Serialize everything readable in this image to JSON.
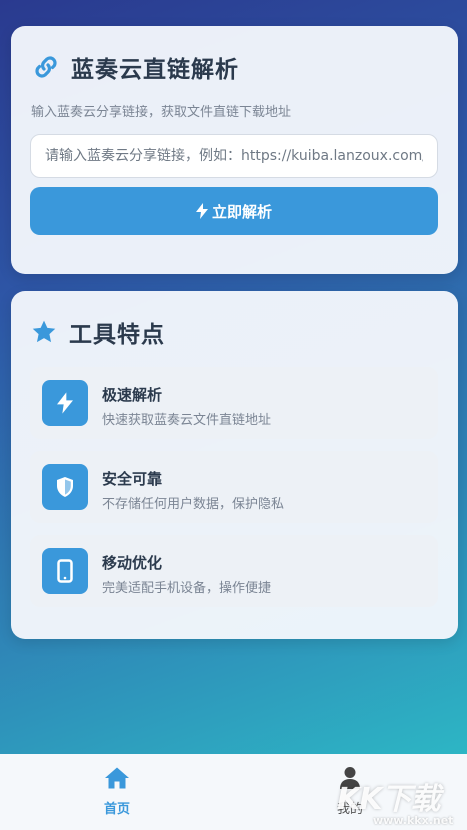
{
  "parse_card": {
    "title": "蓝奏云直链解析",
    "subtitle": "输入蓝奏云分享链接，获取文件直链下载地址",
    "input_placeholder": "请输入蓝奏云分享链接，例如：https://kuiba.lanzoux.com/xxx",
    "input_value": "",
    "button_label": "立即解析"
  },
  "features_card": {
    "title": "工具特点",
    "items": [
      {
        "icon": "bolt-icon",
        "name": "极速解析",
        "desc": "快速获取蓝奏云文件直链地址"
      },
      {
        "icon": "shield-icon",
        "name": "安全可靠",
        "desc": "不存储任何用户数据，保护隐私"
      },
      {
        "icon": "mobile-icon",
        "name": "移动优化",
        "desc": "完美适配手机设备，操作便捷"
      }
    ]
  },
  "bottom_nav": {
    "items": [
      {
        "label": "首页",
        "icon": "home-icon",
        "active": true
      },
      {
        "label": "我的",
        "icon": "user-icon",
        "active": false
      }
    ]
  },
  "watermark": {
    "text": "KK下载",
    "url": "www.kkx.net"
  },
  "colors": {
    "accent": "#3a98db",
    "title_text": "#2b3a4d",
    "muted_text": "#7b8594"
  }
}
